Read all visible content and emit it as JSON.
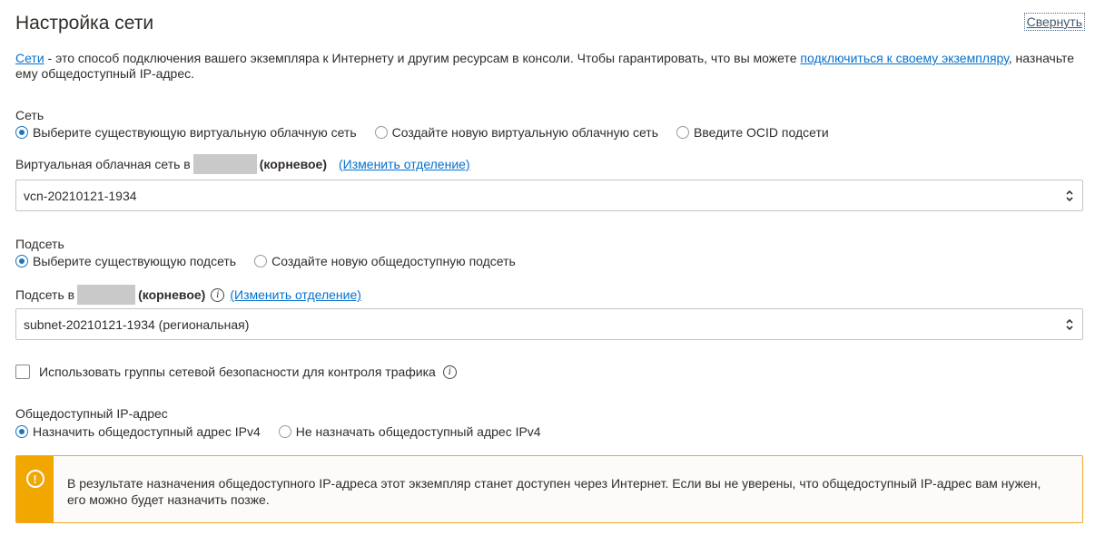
{
  "header": {
    "title": "Настройка сети",
    "collapse_label": "Свернуть"
  },
  "intro": {
    "link1": "Сети",
    "text1": " - это способ подключения вашего экземпляра к Интернету и другим ресурсам в консоли. Чтобы гарантировать, что вы можете ",
    "link2": "подключиться к своему экземпляру",
    "text2": ", назначьте ему общедоступный IP-адрес."
  },
  "network": {
    "label": "Сеть",
    "options": [
      {
        "label": "Выберите существующую виртуальную облачную сеть",
        "selected": true
      },
      {
        "label": "Создайте новую виртуальную облачную сеть",
        "selected": false
      },
      {
        "label": "Введите OCID подсети",
        "selected": false
      }
    ]
  },
  "vcn": {
    "label_prefix": "Виртуальная облачная сеть в",
    "compartment_suffix": "(корневое)",
    "change_link": "(Изменить отделение)",
    "value": "vcn-20210121-1934"
  },
  "subnet_choice": {
    "label": "Подсеть",
    "options": [
      {
        "label": "Выберите существующую подсеть",
        "selected": true
      },
      {
        "label": "Создайте новую общедоступную подсеть",
        "selected": false
      }
    ]
  },
  "subnet": {
    "label_prefix": "Подсеть в",
    "compartment_suffix": "(корневое)",
    "change_link": "(Изменить отделение)",
    "value": "subnet-20210121-1934 (региональная)"
  },
  "nsg": {
    "label": "Использовать группы сетевой безопасности для контроля трафика",
    "checked": false
  },
  "public_ip": {
    "label": "Общедоступный IP-адрес",
    "options": [
      {
        "label": "Назначить общедоступный адрес IPv4",
        "selected": true
      },
      {
        "label": "Не назначать общедоступный адрес IPv4",
        "selected": false
      }
    ]
  },
  "warning": {
    "icon_glyph": "!",
    "text": "В результате назначения общедоступного IP-адреса этот экземпляр станет доступен через Интернет. Если вы не уверены, что общедоступный IP-адрес вам нужен, его можно будет назначить позже."
  },
  "colors": {
    "accent": "#1c75bc",
    "link": "#0572ce",
    "warning": "#f2a600"
  }
}
